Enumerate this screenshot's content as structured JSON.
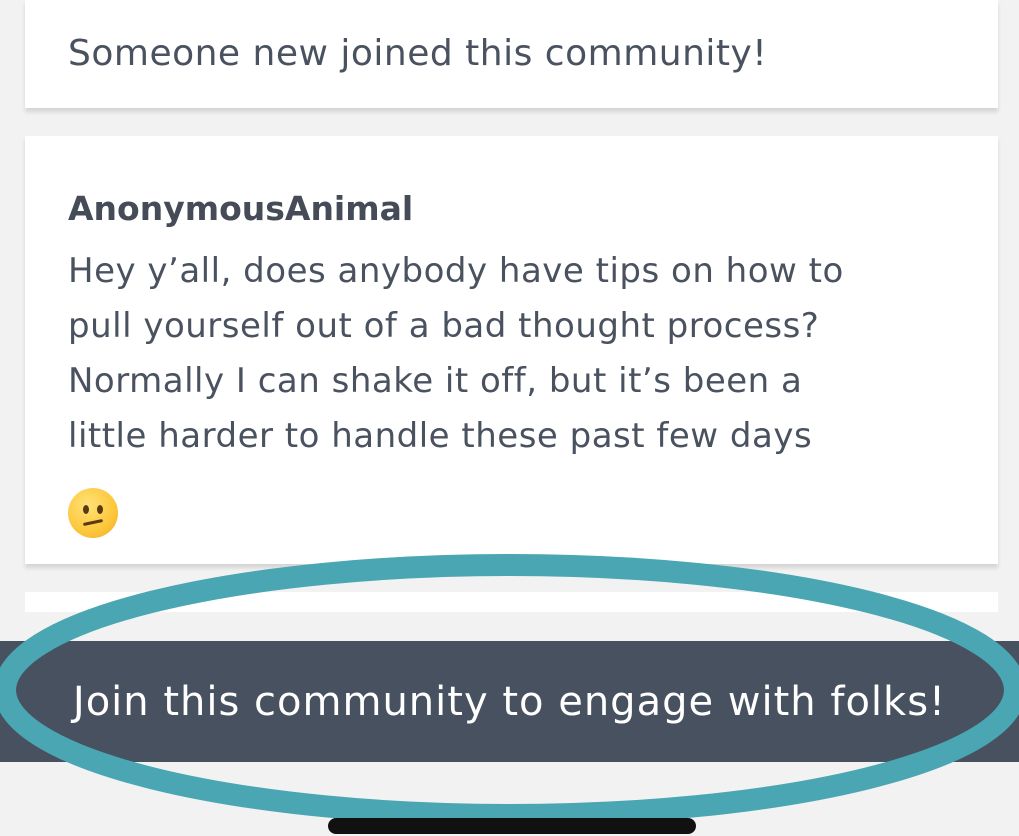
{
  "feed": {
    "activity_card": {
      "text": "Someone new joined this community!"
    },
    "post": {
      "author": "AnonymousAnimal",
      "body_lines": [
        "Hey y’all, does anybody have tips on how to",
        "pull yourself out of a bad thought process?",
        "Normally I can shake it off, but it’s been a",
        "little harder to handle these past few days"
      ],
      "emoji_icon": "confused-face-icon"
    }
  },
  "join_banner": {
    "label": "Join this community to engage with folks!"
  },
  "colors": {
    "background": "#f2f2f2",
    "card": "#ffffff",
    "text": "#4a5260",
    "banner": "#48515f",
    "banner_text": "#ffffff",
    "highlight_ring": "#4aa6b3"
  }
}
